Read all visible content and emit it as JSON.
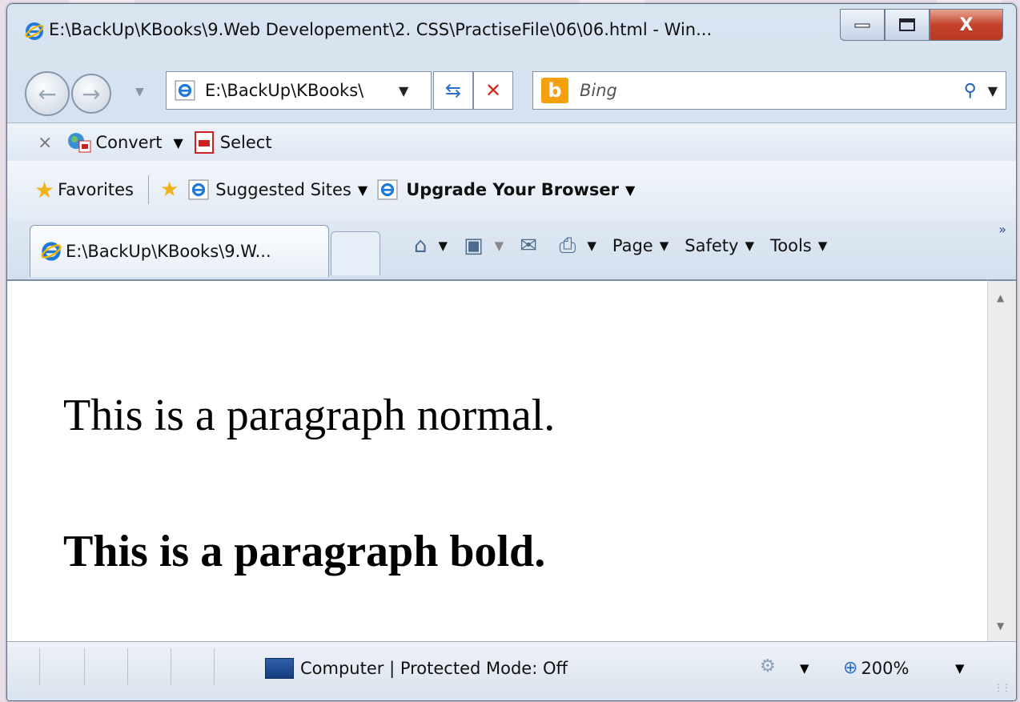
{
  "window": {
    "title": "E:\\BackUp\\KBooks\\9.Web Developement\\2. CSS\\PractiseFile\\06\\06.html - Win...",
    "controls": {
      "minimize": "—",
      "maximize": "☐",
      "close": "X"
    }
  },
  "nav": {
    "address": "E:\\BackUp\\KBooks\\",
    "search_placeholder": "Bing"
  },
  "convert_toolbar": {
    "convert_label": "Convert",
    "select_label": "Select"
  },
  "favorites_bar": {
    "favorites_label": "Favorites",
    "suggested_label": "Suggested Sites",
    "upgrade_label": "Upgrade Your Browser"
  },
  "tabs": [
    {
      "label": "E:\\BackUp\\KBooks\\9.W..."
    }
  ],
  "command_bar": {
    "page_label": "Page",
    "safety_label": "Safety",
    "tools_label": "Tools"
  },
  "content": {
    "paragraph_normal": "This is a paragraph normal.",
    "paragraph_bold": "This is a paragraph bold."
  },
  "status": {
    "zone_text": "Computer | Protected Mode: Off",
    "zoom": "200%"
  },
  "colors": {
    "close_button": "#c2432a",
    "bing_brand": "#f5a10e",
    "chrome_blue": "#d9e4f1"
  }
}
